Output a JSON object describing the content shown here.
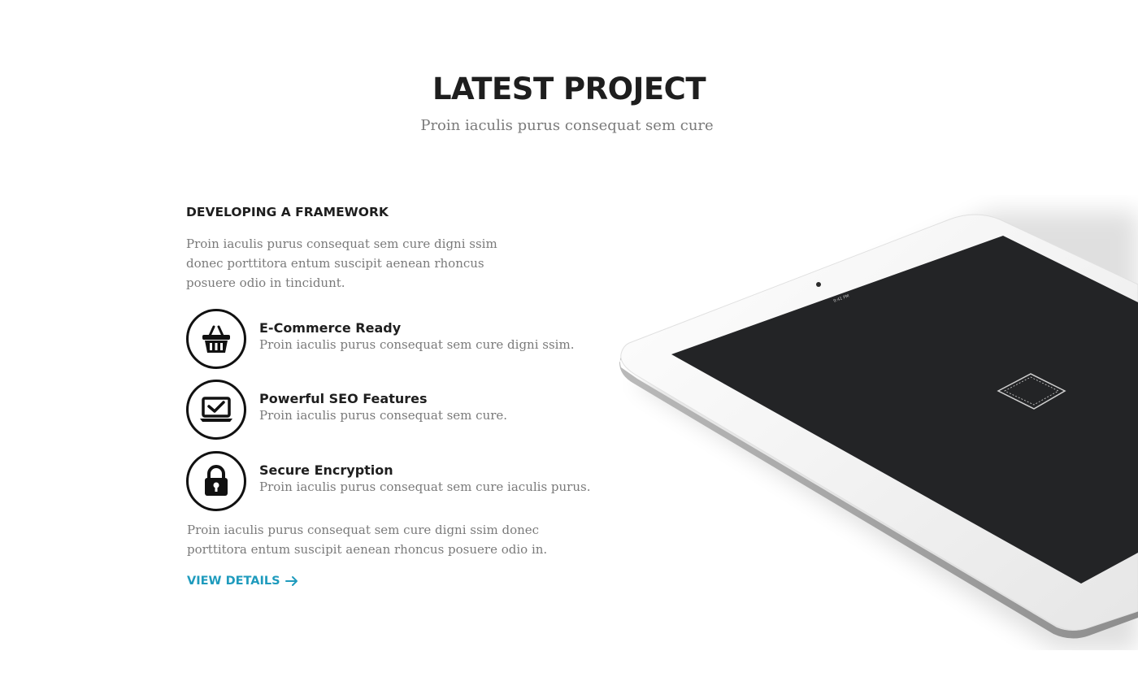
{
  "section": {
    "title": "LATEST PROJECT",
    "subtitle": "Proin iaculis purus consequat sem cure"
  },
  "content": {
    "heading": "DEVELOPING A FRAMEWORK",
    "intro": "Proin iaculis purus consequat sem cure  digni ssim donec porttitora entum suscipit  aenean rhoncus posuere odio in tincidunt.",
    "features": [
      {
        "icon": "shopping-basket-icon",
        "title": "E-Commerce Ready",
        "description": "Proin iaculis purus consequat sem cure  digni ssim."
      },
      {
        "icon": "laptop-check-icon",
        "title": "Powerful SEO Features",
        "description": "Proin iaculis purus consequat sem cure."
      },
      {
        "icon": "padlock-icon",
        "title": "Secure Encryption",
        "description": "Proin iaculis purus consequat sem cure iaculis purus."
      }
    ],
    "outro": "Proin iaculis purus consequat sem cure  digni ssim donec porttitora entum suscipit  aenean rhoncus posuere odio in.",
    "cta_label": "VIEW DETAILS",
    "cta_icon": "arrow-right-icon"
  },
  "colors": {
    "heading": "#1e1e1e",
    "body_text": "#7a7a7a",
    "accent": "#1f9bbd",
    "tablet_screen": "#232426",
    "tablet_frame": "#f4f4f4"
  },
  "device": {
    "icon": "tablet-icon"
  }
}
